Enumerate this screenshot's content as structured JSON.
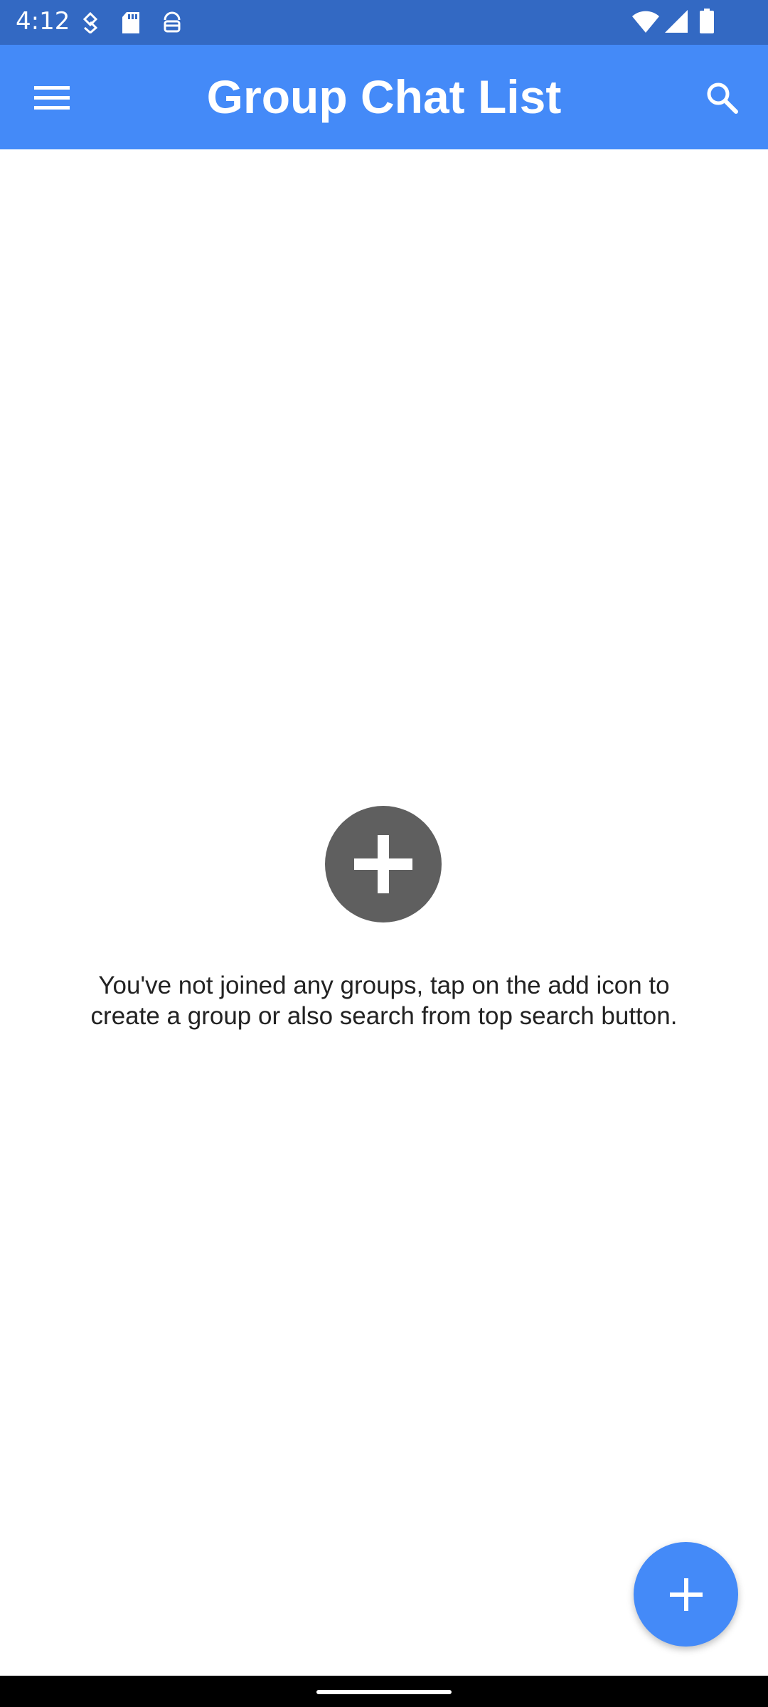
{
  "status_bar": {
    "time": "4:12",
    "icons": [
      "data-saver-icon",
      "sd-card-icon",
      "android-debug-icon",
      "wifi-icon",
      "signal-icon",
      "battery-icon"
    ]
  },
  "app_bar": {
    "title": "Group Chat List",
    "menu_icon": "hamburger-menu-icon",
    "search_icon": "search-icon",
    "color": "#448af8"
  },
  "empty_state": {
    "icon": "add-circle-icon",
    "message_line1": "You've not joined any groups, tap on the add icon to",
    "message_line2": "create a group or also search from top search button."
  },
  "fab": {
    "icon": "plus-icon",
    "color": "#448af8"
  },
  "colors": {
    "status_bar": "#3369c3",
    "primary": "#448af8",
    "empty_icon": "#5f5f5f"
  }
}
